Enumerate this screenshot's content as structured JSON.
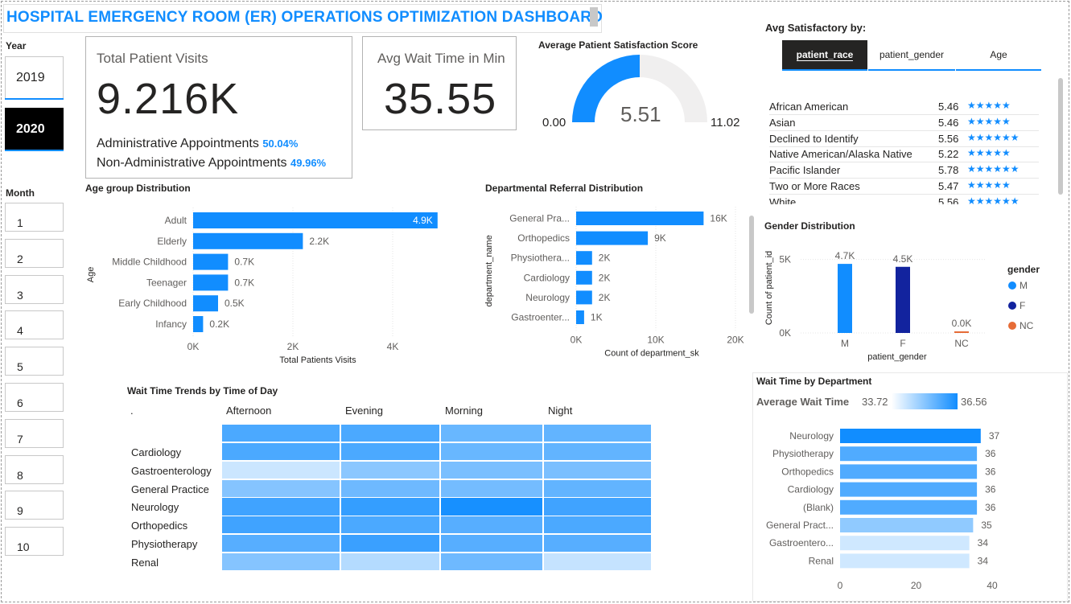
{
  "title": "HOSPITAL EMERGENCY ROOM (ER) OPERATIONS OPTIMIZATION DASHBOARD",
  "year_slicer": {
    "label": "Year",
    "options": [
      "2019",
      "2020"
    ],
    "selected": "2020"
  },
  "month_slicer": {
    "label": "Month",
    "options": [
      "1",
      "2",
      "3",
      "4",
      "5",
      "6",
      "7",
      "8",
      "9",
      "10"
    ]
  },
  "kpi_visits": {
    "label": "Total Patient Visits",
    "value": "9.216K",
    "admin_label": "Administrative Appointments",
    "admin_pct": "50.04%",
    "nonadmin_label": "Non-Administrative Appointments",
    "nonadmin_pct": "49.96%"
  },
  "kpi_wait": {
    "label": "Avg Wait Time in Min",
    "value": "35.55"
  },
  "gauge": {
    "title": "Average Patient Satisfaction Score",
    "value": 5.51,
    "value_label": "5.51",
    "min": 0,
    "max": 11.02,
    "min_label": "0.00",
    "max_label": "11.02"
  },
  "satisfaction": {
    "title": "Avg Satisfactory by:",
    "tabs": [
      "patient_race",
      "patient_gender",
      "Age"
    ],
    "active_tab": "patient_race",
    "rows": [
      {
        "name": "African American",
        "score": "5.46",
        "stars": "★★★★★"
      },
      {
        "name": "Asian",
        "score": "5.46",
        "stars": "★★★★★"
      },
      {
        "name": "Declined to Identify",
        "score": "5.56",
        "stars": "★★★★★★"
      },
      {
        "name": "Native American/Alaska Native",
        "score": "5.22",
        "stars": "★★★★★"
      },
      {
        "name": "Pacific Islander",
        "score": "5.78",
        "stars": "★★★★★★"
      },
      {
        "name": "Two or More Races",
        "score": "5.47",
        "stars": "★★★★★"
      },
      {
        "name": "White",
        "score": "5.56",
        "stars": "★★★★★★"
      }
    ]
  },
  "colors": {
    "accent": "#118dff",
    "dark_blue": "#12239e",
    "orange": "#e66c37",
    "gauge_bg": "#f0efef"
  },
  "chart_data": [
    {
      "id": "age",
      "type": "bar",
      "orientation": "horizontal",
      "title": "Age group Distribution",
      "xlabel": "Total Patients Visits",
      "ylabel": "Age",
      "categories": [
        "Adult",
        "Elderly",
        "Middle Childhood",
        "Teenager",
        "Early Childhood",
        "Infancy"
      ],
      "values": [
        4.9,
        2.2,
        0.7,
        0.7,
        0.5,
        0.2
      ],
      "value_labels": [
        "4.9K",
        "2.2K",
        "0.7K",
        "0.7K",
        "0.5K",
        "0.2K"
      ],
      "xlim": [
        0,
        5
      ],
      "xticks": [
        0,
        2,
        4
      ],
      "xtick_labels": [
        "0K",
        "2K",
        "4K"
      ],
      "grid": true
    },
    {
      "id": "dept",
      "type": "bar",
      "orientation": "horizontal",
      "title": "Departmental Referral Distribution",
      "xlabel": "Count of department_sk",
      "ylabel": "department_name",
      "categories": [
        "General Pra...",
        "Orthopedics",
        "Physiothera...",
        "Cardiology",
        "Neurology",
        "Gastroenter..."
      ],
      "values": [
        16,
        9,
        2,
        2,
        2,
        1
      ],
      "value_labels": [
        "16K",
        "9K",
        "2K",
        "2K",
        "2K",
        "1K"
      ],
      "xlim": [
        0,
        20
      ],
      "xticks": [
        0,
        10,
        20
      ],
      "xtick_labels": [
        "0K",
        "10K",
        "20K"
      ],
      "grid": true
    },
    {
      "id": "gender",
      "type": "bar",
      "title": "Gender Distribution",
      "xlabel": "patient_gender",
      "ylabel": "Count of patient_id",
      "categories": [
        "M",
        "F",
        "NC"
      ],
      "values": [
        4.7,
        4.5,
        0.01
      ],
      "value_labels": [
        "4.7K",
        "4.5K",
        "0.0K"
      ],
      "bar_colors": [
        "#118dff",
        "#12239e",
        "#e66c37"
      ],
      "ylim": [
        0,
        5.8
      ],
      "yticks": [
        0,
        5
      ],
      "ytick_labels": [
        "0K",
        "5K"
      ],
      "legend": {
        "title": "gender",
        "items": [
          "M",
          "F",
          "NC"
        ],
        "position": "right"
      }
    },
    {
      "id": "heatmap",
      "type": "heatmap",
      "title": "Wait Time Trends by Time of Day",
      "corner_label": ".",
      "columns": [
        "Afternoon",
        "Evening",
        "Morning",
        "Night"
      ],
      "rows": [
        "Cardiology",
        "Gastroenterology",
        "General Practice",
        "Neurology",
        "Orthopedics",
        "Physiotherapy",
        "Renal"
      ],
      "values": [
        [
          36.0,
          36.0,
          35.5,
          35.6,
          35.6
        ],
        [
          36.2,
          36.0,
          35.8,
          35.8
        ],
        [
          33.8,
          34.9,
          35.2,
          35.2
        ],
        [
          35.0,
          35.4,
          35.3,
          35.6
        ],
        [
          36.2,
          36.4,
          36.9,
          36.2
        ],
        [
          36.2,
          36.0,
          35.8,
          36.0
        ],
        [
          35.8,
          36.3,
          35.8,
          35.8
        ],
        [
          35.0,
          34.2,
          35.4,
          33.9
        ]
      ],
      "min": 33.7,
      "max": 37.0
    },
    {
      "id": "wait_dept",
      "type": "bar",
      "orientation": "horizontal",
      "title": "Wait Time by Department",
      "legend_label": "Average Wait Time",
      "legend_min": "33.72",
      "legend_max": "36.56",
      "categories": [
        "Neurology",
        "Physiotherapy",
        "Orthopedics",
        "Cardiology",
        "(Blank)",
        "General Pract...",
        "Gastroentero...",
        "Renal"
      ],
      "values": [
        37,
        36,
        36,
        36,
        36,
        35,
        34,
        34
      ],
      "value_labels": [
        "37",
        "36",
        "36",
        "36",
        "36",
        "35",
        "34",
        "34"
      ],
      "xlim": [
        0,
        40
      ],
      "xticks": [
        0,
        20,
        40
      ],
      "xtick_labels": [
        "0",
        "20",
        "40"
      ]
    }
  ]
}
